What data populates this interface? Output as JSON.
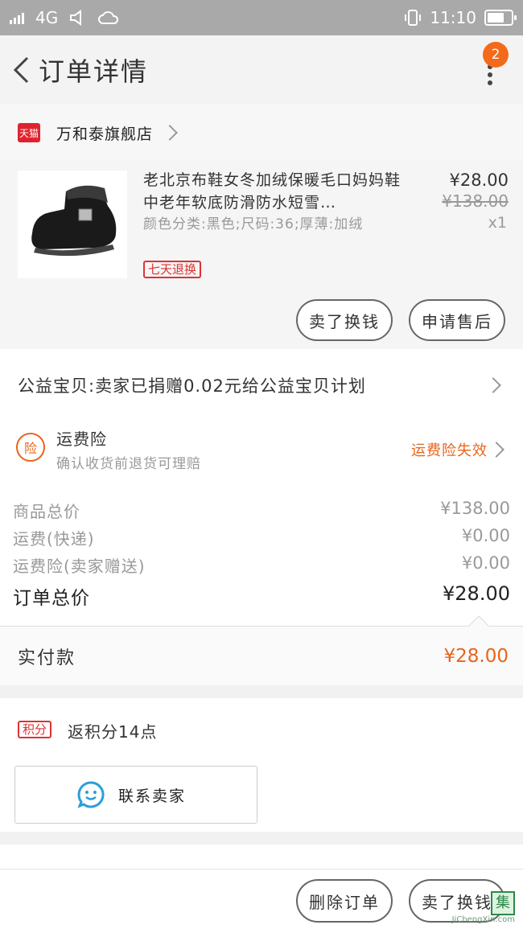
{
  "status_bar": {
    "network": "4G",
    "time": "11:10"
  },
  "nav": {
    "title": "订单详情",
    "badge_count": "2"
  },
  "shop": {
    "platform_badge": "天猫",
    "name": "万和泰旗舰店"
  },
  "product": {
    "title": "老北京布鞋女冬加绒保暖毛口妈妈鞋中老年软底防滑防水短雪…",
    "spec": "颜色分类:黑色;尺码:36;厚薄:加绒",
    "tag": "七天退换",
    "price": "¥28.00",
    "original_price": "¥138.00",
    "quantity": "x1",
    "buttons": {
      "exchange": "卖了换钱",
      "after_sale": "申请售后"
    }
  },
  "charity": {
    "text": "公益宝贝:卖家已捐赠0.02元给公益宝贝计划"
  },
  "shipping_insurance": {
    "icon_char": "险",
    "title": "运费险",
    "subtitle": "确认收货前退货可理赔",
    "status": "运费险失效"
  },
  "costs": [
    {
      "label": "商品总价",
      "value": "¥138.00"
    },
    {
      "label": "运费(快递)",
      "value": "¥0.00"
    },
    {
      "label": "运费险(卖家赠送)",
      "value": "¥0.00"
    }
  ],
  "order_total": {
    "label": "订单总价",
    "value": "¥28.00"
  },
  "paid": {
    "label": "实付款",
    "value": "¥28.00"
  },
  "points": {
    "tag": "积分",
    "text": "返积分14点"
  },
  "contact": {
    "label": "联系卖家"
  },
  "bottom_bar": {
    "delete_order": "删除订单",
    "exchange": "卖了换钱"
  },
  "watermark": {
    "char": "集",
    "text": "JiChengXin.com"
  },
  "colors": {
    "accent": "#e9641b",
    "tmall_red": "#e0222f",
    "badge": "#f36a1a"
  }
}
